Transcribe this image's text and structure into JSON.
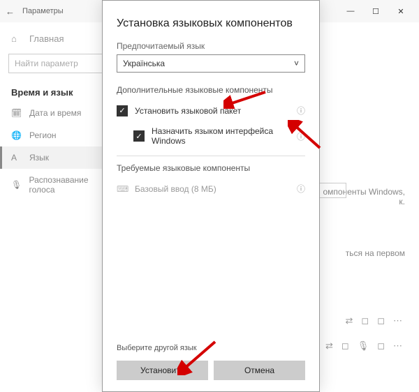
{
  "titlebar": {
    "title": "Параметры"
  },
  "sidebar": {
    "home": "Главная",
    "search_placeholder": "Найти параметр",
    "header": "Время и язык",
    "items": [
      {
        "label": "Дата и время"
      },
      {
        "label": "Регион"
      },
      {
        "label": "Язык"
      },
      {
        "label": "Распознавание голоса"
      }
    ]
  },
  "right": {
    "fragment1": "омпоненты Windows,",
    "fragment1b": "к.",
    "fragment2": "ться на первом"
  },
  "dialog": {
    "title": "Установка языковых компонентов",
    "preferred_label": "Предпочитаемый язык",
    "language": "Українська",
    "section_optional": "Дополнительные языковые компоненты",
    "opt1": "Установить языковой пакет",
    "opt2": "Назначить языком интерфейса Windows",
    "section_required": "Требуемые языковые компоненты",
    "req1": "Базовый ввод (8 МБ)",
    "other": "Выберите другой язык",
    "install": "Установить",
    "cancel": "Отмена"
  }
}
